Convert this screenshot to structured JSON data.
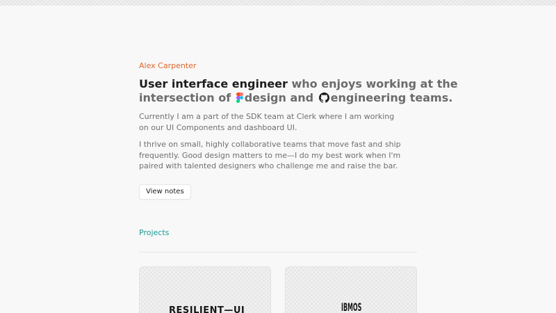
{
  "profile": {
    "name": "Alex Carpenter",
    "headline": {
      "role": "User interface engineer",
      "part1": " who enjoys working at the",
      "part2": "intersection of ",
      "design": "design and ",
      "engineering": "engineering teams."
    },
    "paragraphs": [
      "Currently I am a part of the SDK team at Clerk where I am working on our UI Components and dashboard UI.",
      "I thrive on small, highly collaborative teams that move fast and ship frequently. Good design matters to me—I do my best work when I'm paired with talented designers who challenge me and raise the bar."
    ],
    "notes_button": "View notes"
  },
  "projects": {
    "label": "Projects",
    "cards": [
      {
        "logo_text": "RESILIENT—UI"
      },
      {
        "logo_text": "IBMOS"
      }
    ]
  },
  "icons": {
    "design": "figma-icon",
    "engineering": "github-icon"
  },
  "colors": {
    "name_accent": "#e0662a",
    "projects_accent": "#1a9a96",
    "background": "#f8f8f8"
  }
}
